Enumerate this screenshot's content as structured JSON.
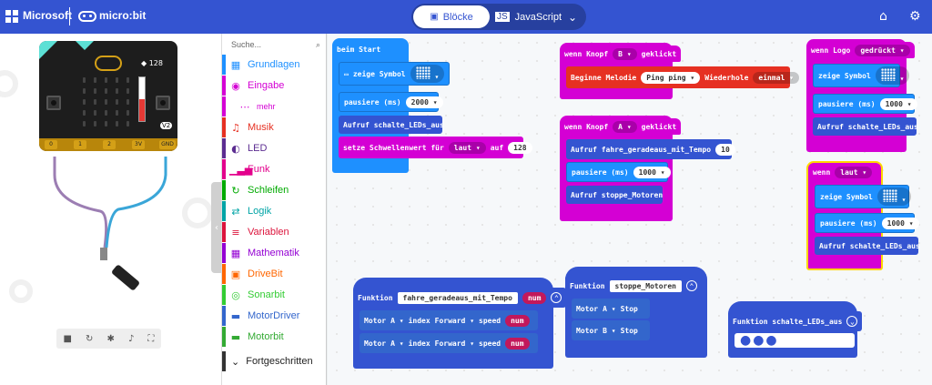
{
  "header": {
    "brand": "Microsoft",
    "product": "micro:bit",
    "tabs": [
      "Blöcke",
      "JavaScript"
    ],
    "icons": [
      "home-icon",
      "gear-icon"
    ]
  },
  "simulator": {
    "level": "128",
    "pins": [
      "0",
      "1",
      "2",
      "3V",
      "GND"
    ],
    "version": "V2",
    "controls": [
      "stop-icon",
      "restart-icon",
      "debug-icon",
      "sound-icon",
      "fullscreen-icon"
    ]
  },
  "toolbox": {
    "search_placeholder": "Suche...",
    "categories": [
      {
        "label": "Grundlagen",
        "color": "#1e90ff",
        "icon": "grid-icon"
      },
      {
        "label": "Eingabe",
        "color": "#d400d4",
        "icon": "target-icon"
      },
      {
        "label": "mehr",
        "color": "#d400d4",
        "icon": "dots-icon"
      },
      {
        "label": "Musik",
        "color": "#e63022",
        "icon": "headphones-icon"
      },
      {
        "label": "LED",
        "color": "#5c2d91",
        "icon": "toggle-icon"
      },
      {
        "label": "Funk",
        "color": "#e3008c",
        "icon": "signal-icon"
      },
      {
        "label": "Schleifen",
        "color": "#00aa00",
        "icon": "loop-icon"
      },
      {
        "label": "Logik",
        "color": "#00a4a6",
        "icon": "logic-icon"
      },
      {
        "label": "Variablen",
        "color": "#dc143c",
        "icon": "list-icon"
      },
      {
        "label": "Mathematik",
        "color": "#9400d3",
        "icon": "calculator-icon"
      },
      {
        "label": "DriveBit",
        "color": "#ff6600",
        "icon": "briefcase-icon"
      },
      {
        "label": "Sonarbit",
        "color": "#33cc33",
        "icon": "sonar-icon"
      },
      {
        "label": "MotorDriver",
        "color": "#3366cc",
        "icon": "car-icon"
      },
      {
        "label": "Motorbit",
        "color": "#33aa33",
        "icon": "car-icon"
      }
    ],
    "advanced": "Fortgeschritten"
  },
  "workspace": {
    "on_start": {
      "title": "beim Start",
      "show_icon": "zeige Symbol",
      "pause_label": "pausiere (ms)",
      "pause_value": "2000",
      "call": "Aufruf schalte_LEDs_aus",
      "threshold_label": "setze Schwellenwert für",
      "threshold_kind": "laut",
      "threshold_on": "auf",
      "threshold_value": "128"
    },
    "button_b": {
      "title_pre": "wenn Knopf",
      "button": "B",
      "title_post": "geklickt",
      "melody_label": "Beginne Melodie",
      "melody": "Ping ping",
      "repeat_label": "Wiederhole",
      "repeat": "einmal"
    },
    "button_a": {
      "title_pre": "wenn Knopf",
      "button": "A",
      "title_post": "geklickt",
      "call_forward": "Aufruf fahre_geradeaus_mit_Tempo",
      "call_value": "10",
      "pause_label": "pausiere (ms)",
      "pause_value": "1000",
      "call_stop": "Aufruf stoppe_Motoren"
    },
    "logo": {
      "title": "wenn Logo",
      "state": "gedrückt",
      "show_icon": "zeige Symbol",
      "pause_label": "pausiere (ms)",
      "pause_value": "1000",
      "call": "Aufruf schalte_LEDs_aus"
    },
    "loud": {
      "title": "wenn",
      "kind": "laut",
      "show_icon": "zeige Symbol",
      "pause_label": "pausiere (ms)",
      "pause_value": "1000",
      "call": "Aufruf schalte_LEDs_aus"
    },
    "func_forward": {
      "keyword": "Funktion",
      "name": "fahre_geradeaus_mit_Tempo",
      "param": "num",
      "rows": [
        {
          "motor": "Motor",
          "which": "A",
          "index": "index",
          "dir": "Forward",
          "speed": "speed",
          "val": "num"
        },
        {
          "motor": "Motor",
          "which": "A",
          "index": "index",
          "dir": "Forward",
          "speed": "speed",
          "val": "num"
        }
      ]
    },
    "func_stop": {
      "keyword": "Funktion",
      "name": "stoppe_Motoren",
      "rows": [
        {
          "motor": "Motor",
          "which": "A",
          "action": "Stop"
        },
        {
          "motor": "Motor",
          "which": "B",
          "action": "Stop"
        }
      ]
    },
    "func_leds": {
      "label": "Funktion schalte_LEDs_aus"
    }
  }
}
